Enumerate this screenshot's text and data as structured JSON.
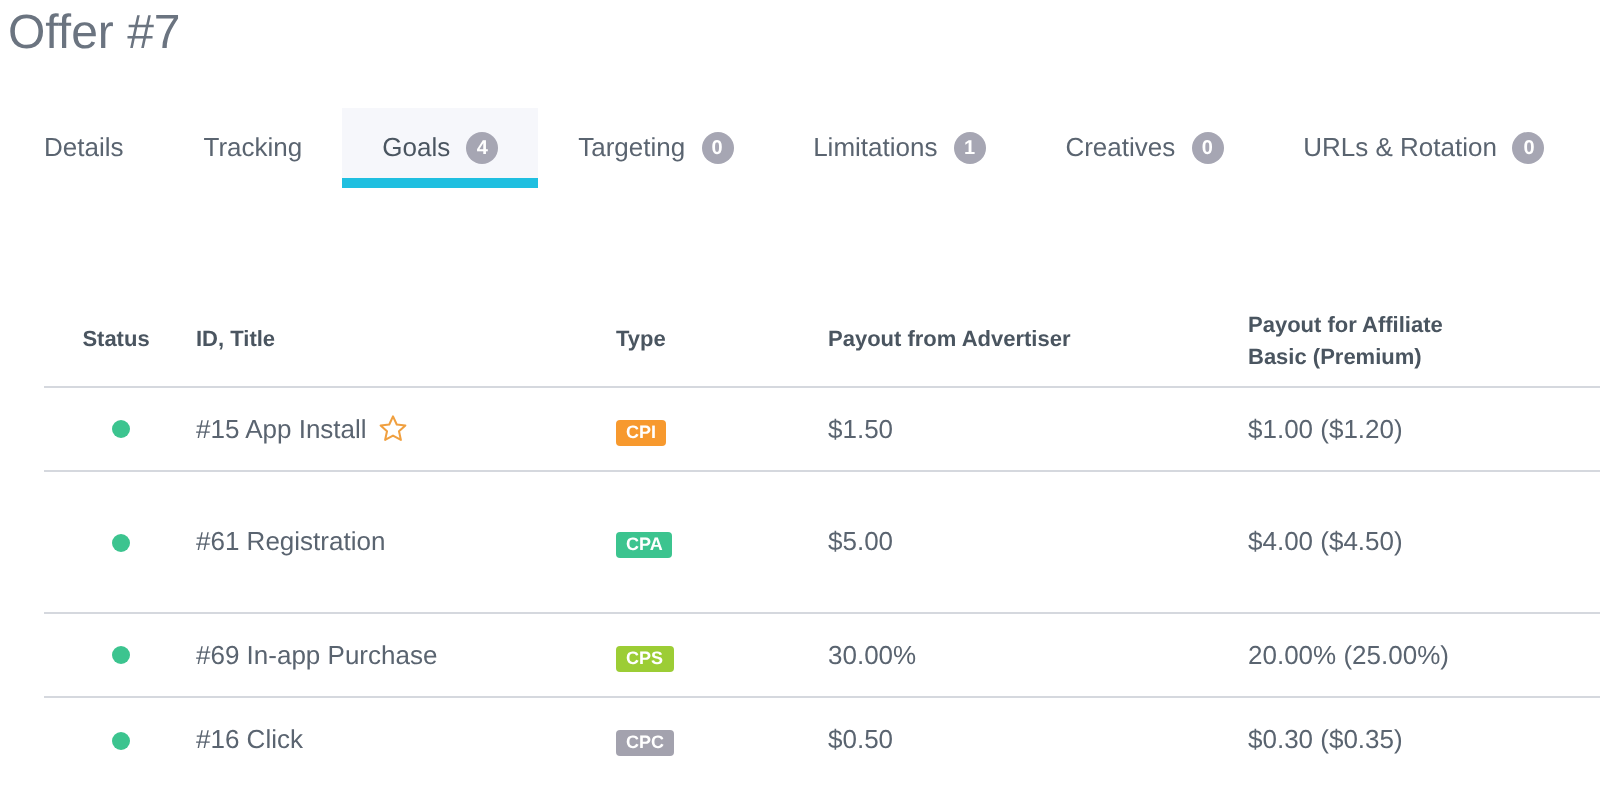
{
  "title": "Offer #7",
  "tabs": [
    {
      "label": "Details",
      "selected": false
    },
    {
      "label": "Tracking",
      "selected": false
    },
    {
      "label": "Goals",
      "count": "4",
      "selected": true
    },
    {
      "label": "Targeting",
      "count": "0",
      "selected": false
    },
    {
      "label": "Limitations",
      "count": "1",
      "selected": false
    },
    {
      "label": "Creatives",
      "count": "0",
      "selected": false
    },
    {
      "label": "URLs & Rotation",
      "count": "0",
      "selected": false
    }
  ],
  "table": {
    "columns": [
      "Status",
      "ID, Title",
      "Type",
      "Payout from Advertiser",
      "Payout for Affiliate Basic (Premium)"
    ],
    "rows": [
      {
        "active": true,
        "title": "#15 App Install",
        "starred": true,
        "type": "CPI",
        "color": "#f7992e",
        "payout": "$1.50",
        "affiliate_payout": "$1.00 ($1.20)"
      },
      {
        "active": true,
        "title": "#61 Registration",
        "starred": false,
        "type": "CPA",
        "color": "#3cc48f",
        "payout": "$5.00",
        "affiliate_payout": "$4.00 ($4.50)"
      },
      {
        "active": true,
        "title": "#69 In-app Purchase",
        "starred": false,
        "type": "CPS",
        "color": "#9ccd35",
        "payout": "30.00%",
        "affiliate_payout": "20.00% (25.00%)"
      },
      {
        "active": true,
        "title": "#16 Click",
        "starred": false,
        "type": "CPC",
        "color": "#a3a2ae",
        "payout": "$0.50",
        "affiliate_payout": "$0.30 ($0.35)"
      }
    ]
  }
}
